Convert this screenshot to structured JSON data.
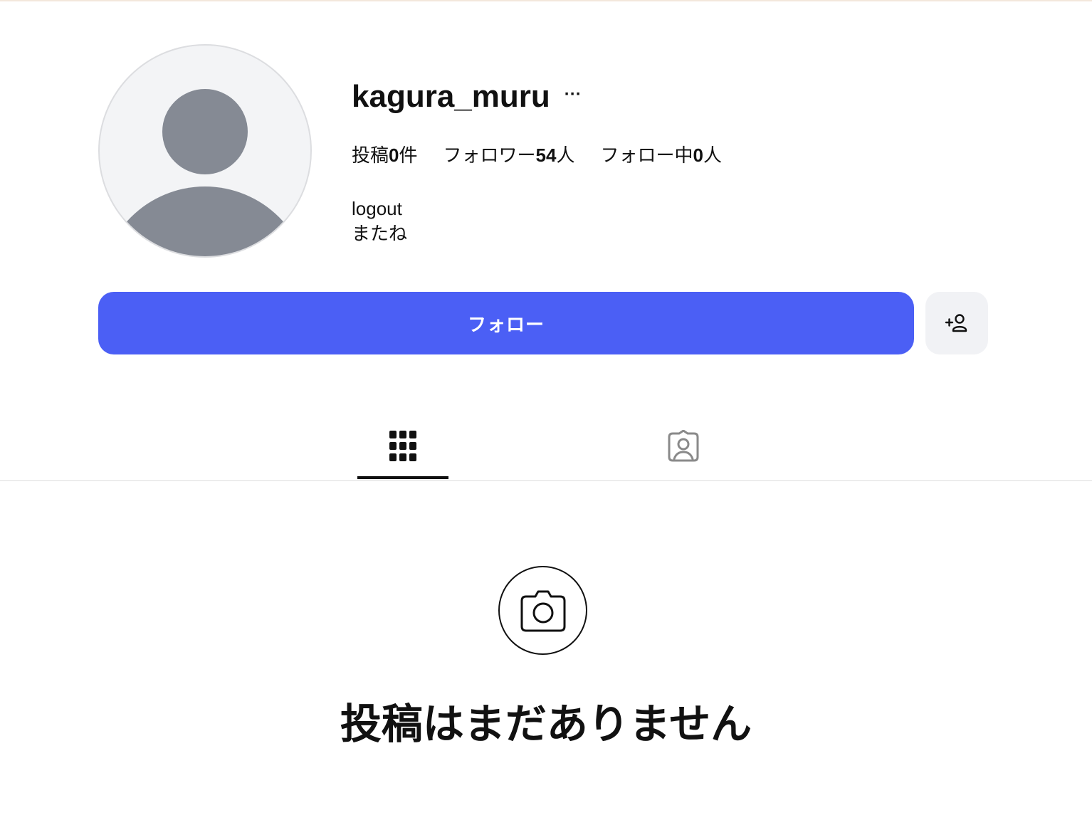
{
  "profile": {
    "username": "kagura_muru",
    "more_label": "···",
    "stats": {
      "posts_label": "投稿",
      "posts_count": "0",
      "posts_unit": "件",
      "followers_label": "フォロワー",
      "followers_count": "54",
      "followers_unit": "人",
      "following_label": "フォロー中",
      "following_count": "0",
      "following_unit": "人"
    },
    "bio_line1": "logout",
    "bio_line2": "またね"
  },
  "actions": {
    "follow_label": "フォロー",
    "add_user_icon": "add-user-icon"
  },
  "tabs": [
    {
      "icon": "grid-icon",
      "active": true
    },
    {
      "icon": "tagged-person-icon",
      "active": false
    }
  ],
  "empty_state": {
    "icon": "camera-icon",
    "title": "投稿はまだありません"
  },
  "colors": {
    "accent": "#4b5ff5",
    "avatar_bg": "#f3f4f6",
    "avatar_fg": "#858a94",
    "secondary_button_bg": "#f1f2f5"
  }
}
